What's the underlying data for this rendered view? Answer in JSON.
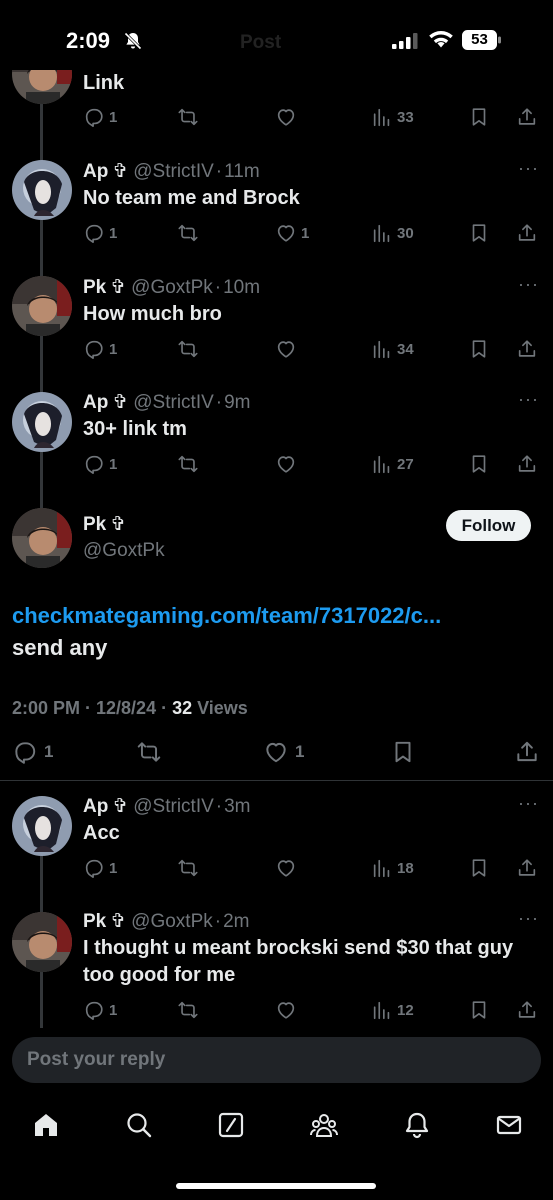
{
  "status": {
    "time": "2:09",
    "battery": "53",
    "ghost_title": "Post"
  },
  "tweets_above": [
    {
      "body": "Link",
      "actions": {
        "reply": "1",
        "retweet": "",
        "like": "",
        "views": "33"
      },
      "avatar": "pk"
    },
    {
      "name": "Ap",
      "badge": "✞",
      "handle": "@StrictIV",
      "time": "11m",
      "body": "No team me and Brock",
      "actions": {
        "reply": "1",
        "retweet": "",
        "like": "1",
        "views": "30"
      },
      "avatar": "ap"
    },
    {
      "name": "Pk",
      "badge": "✞",
      "handle": "@GoxtPk",
      "time": "10m",
      "body": "How much bro",
      "actions": {
        "reply": "1",
        "retweet": "",
        "like": "",
        "views": "34"
      },
      "avatar": "pk"
    },
    {
      "name": "Ap",
      "badge": "✞",
      "handle": "@StrictIV",
      "time": "9m",
      "body": "30+ link tm",
      "actions": {
        "reply": "1",
        "retweet": "",
        "like": "",
        "views": "27"
      },
      "avatar": "ap"
    }
  ],
  "main_tweet": {
    "name": "Pk",
    "badge": "✞",
    "handle": "@GoxtPk",
    "follow_label": "Follow",
    "link": "checkmategaming.com/team/7317022/c...",
    "text": "send any",
    "timestamp": "2:00 PM · 12/8/24 · ",
    "views_count": "32",
    "views_label": " Views",
    "actions": {
      "reply": "1",
      "retweet": "",
      "like": "1"
    }
  },
  "replies": [
    {
      "name": "Ap",
      "badge": "✞",
      "handle": "@StrictIV",
      "time": "3m",
      "body": "Acc",
      "actions": {
        "reply": "1",
        "retweet": "",
        "like": "",
        "views": "18"
      },
      "avatar": "ap"
    },
    {
      "name": "Pk",
      "badge": "✞",
      "handle": "@GoxtPk",
      "time": "2m",
      "body": "I thought u meant brockski send $30 that guy too good for me",
      "actions": {
        "reply": "1",
        "retweet": "",
        "like": "",
        "views": "12"
      },
      "avatar": "pk"
    }
  ],
  "reply_bar": {
    "placeholder": "Post your reply"
  },
  "tabbar": [
    "home-icon",
    "search-icon",
    "grok-icon",
    "communities-icon",
    "notifications-icon",
    "messages-icon"
  ],
  "colors": {
    "background": "#000000",
    "accent": "#1d9bf0",
    "muted": "#71767b",
    "text": "#e7e9ea"
  }
}
